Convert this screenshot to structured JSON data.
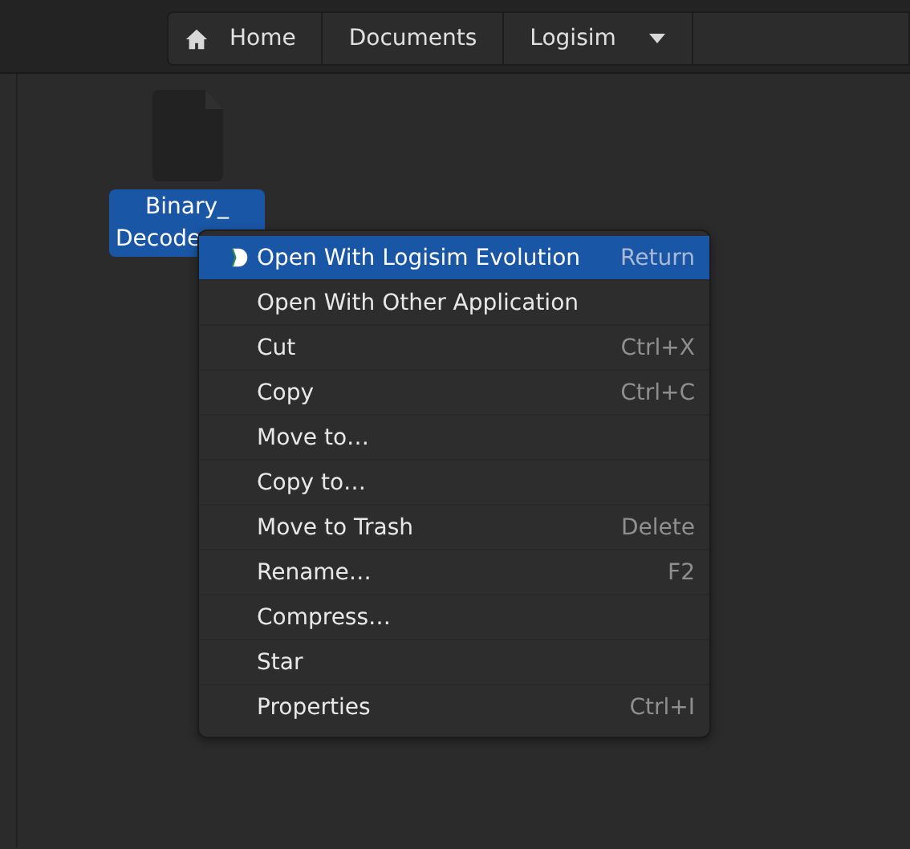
{
  "path_bar": [
    {
      "label": "Home",
      "kind": "home",
      "dropdown": false
    },
    {
      "label": "Documents",
      "kind": "folder",
      "dropdown": false
    },
    {
      "label": "Logisim",
      "kind": "folder",
      "dropdown": true
    }
  ],
  "files": [
    {
      "name_lines": [
        "Binary_",
        "Decode"
      ],
      "selected": true
    }
  ],
  "context_menu": [
    {
      "label": "Open With Logisim Evolution",
      "shortcut": "Return",
      "kind": "app",
      "selected": true
    },
    {
      "label": "Open With Other Application",
      "kind": "action",
      "selected": false
    },
    {
      "label": "Cut",
      "shortcut": "Ctrl+X",
      "kind": "action",
      "selected": false
    },
    {
      "label": "Copy",
      "shortcut": "Ctrl+C",
      "kind": "action",
      "selected": false
    },
    {
      "label": "Move to…",
      "kind": "action",
      "selected": false
    },
    {
      "label": "Copy to…",
      "kind": "action",
      "selected": false
    },
    {
      "label": "Move to Trash",
      "shortcut": "Delete",
      "kind": "action",
      "selected": false
    },
    {
      "label": "Rename…",
      "shortcut": "F2",
      "kind": "action",
      "selected": false
    },
    {
      "label": "Compress…",
      "kind": "action",
      "selected": false
    },
    {
      "label": "Star",
      "kind": "action",
      "selected": false
    },
    {
      "label": "Properties",
      "shortcut": "Ctrl+I",
      "kind": "action",
      "selected": false
    }
  ]
}
